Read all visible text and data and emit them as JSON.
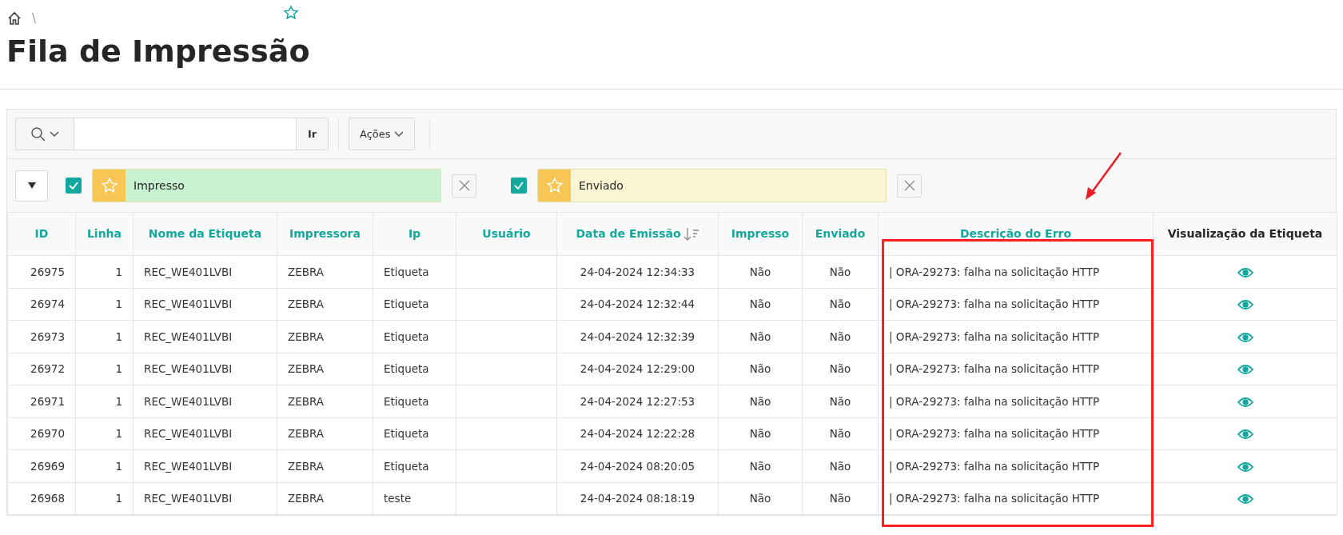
{
  "breadcrumb": {
    "separator": "\\"
  },
  "page_title": "Fila de Impressão",
  "toolbar": {
    "go_button": "Ir",
    "actions_button": "Ações"
  },
  "filters": [
    {
      "label": "Impresso",
      "checked": true,
      "color": "#c8f2d0"
    },
    {
      "label": "Enviado",
      "checked": true,
      "color": "#faf5d2"
    }
  ],
  "table": {
    "columns": [
      {
        "label": "ID",
        "sorted": false,
        "highlighted": false,
        "kind": "text"
      },
      {
        "label": "Linha",
        "sorted": false,
        "highlighted": false,
        "kind": "text"
      },
      {
        "label": "Nome da Etiqueta",
        "sorted": false,
        "highlighted": false,
        "kind": "text"
      },
      {
        "label": "Impressora",
        "sorted": false,
        "highlighted": false,
        "kind": "text"
      },
      {
        "label": "Ip",
        "sorted": false,
        "highlighted": false,
        "kind": "text"
      },
      {
        "label": "Usuário",
        "sorted": false,
        "highlighted": false,
        "kind": "text"
      },
      {
        "label": "Data de Emissão",
        "sorted": true,
        "highlighted": false,
        "kind": "text"
      },
      {
        "label": "Impresso",
        "sorted": false,
        "highlighted": false,
        "kind": "text"
      },
      {
        "label": "Enviado",
        "sorted": false,
        "highlighted": false,
        "kind": "text"
      },
      {
        "label": "Descrição do Erro",
        "sorted": false,
        "highlighted": true,
        "kind": "text"
      },
      {
        "label": "Visualização da Etiqueta",
        "sorted": false,
        "highlighted": false,
        "kind": "link"
      }
    ],
    "rows": [
      [
        "26975",
        "1",
        "REC_WE401LVBI",
        "ZEBRA",
        "Etiqueta",
        "",
        "24-04-2024 12:34:33",
        "Não",
        "Não",
        "| ORA-29273: falha na solicitação HTTP"
      ],
      [
        "26974",
        "1",
        "REC_WE401LVBI",
        "ZEBRA",
        "Etiqueta",
        "",
        "24-04-2024 12:32:44",
        "Não",
        "Não",
        "| ORA-29273: falha na solicitação HTTP"
      ],
      [
        "26973",
        "1",
        "REC_WE401LVBI",
        "ZEBRA",
        "Etiqueta",
        "",
        "24-04-2024 12:32:39",
        "Não",
        "Não",
        "| ORA-29273: falha na solicitação HTTP"
      ],
      [
        "26972",
        "1",
        "REC_WE401LVBI",
        "ZEBRA",
        "Etiqueta",
        "",
        "24-04-2024 12:29:00",
        "Não",
        "Não",
        "| ORA-29273: falha na solicitação HTTP"
      ],
      [
        "26971",
        "1",
        "REC_WE401LVBI",
        "ZEBRA",
        "Etiqueta",
        "",
        "24-04-2024 12:27:53",
        "Não",
        "Não",
        "| ORA-29273: falha na solicitação HTTP"
      ],
      [
        "26970",
        "1",
        "REC_WE401LVBI",
        "ZEBRA",
        "Etiqueta",
        "",
        "24-04-2024 12:22:28",
        "Não",
        "Não",
        "| ORA-29273: falha na solicitação HTTP"
      ],
      [
        "26969",
        "1",
        "REC_WE401LVBI",
        "ZEBRA",
        "Etiqueta",
        "",
        "24-04-2024 08:20:05",
        "Não",
        "Não",
        "| ORA-29273: falha na solicitação HTTP"
      ],
      [
        "26968",
        "1",
        "REC_WE401LVBI",
        "ZEBRA",
        "teste",
        "",
        "24-04-2024 08:18:19",
        "Não",
        "Não",
        "| ORA-29273: falha na solicitação HTTP"
      ]
    ]
  }
}
